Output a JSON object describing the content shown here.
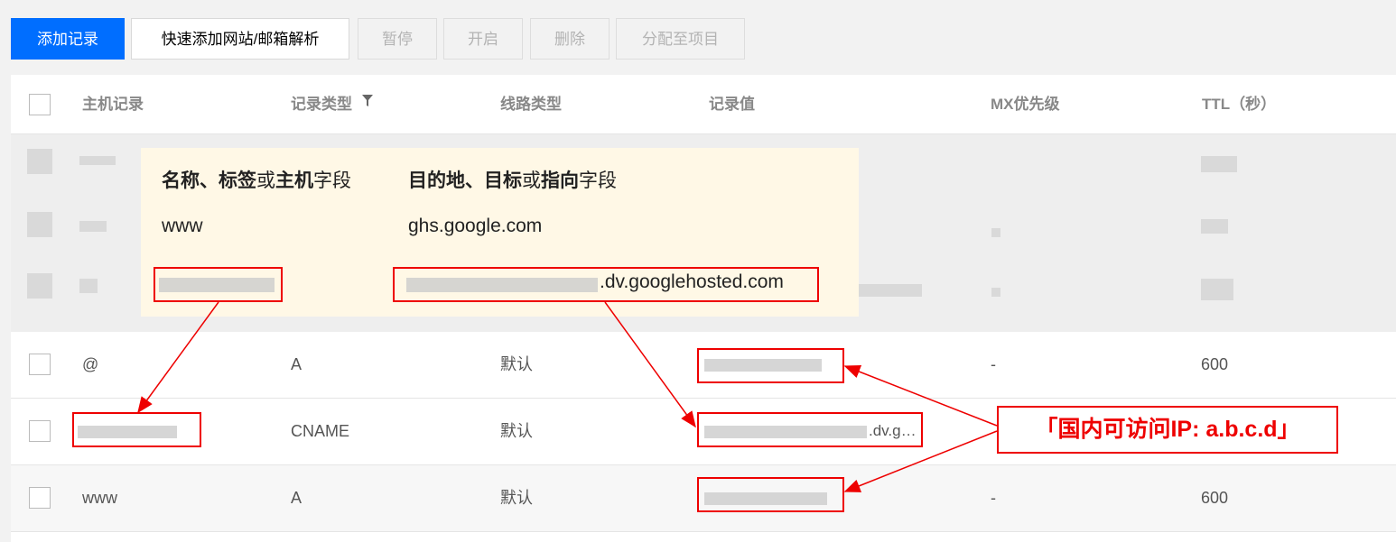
{
  "toolbar": {
    "add_record": "添加记录",
    "quick_add": "快速添加网站/邮箱解析",
    "pause": "暂停",
    "enable": "开启",
    "delete": "删除",
    "assign_project": "分配至项目"
  },
  "table": {
    "columns": {
      "host": "主机记录",
      "type": "记录类型",
      "line": "线路类型",
      "value": "记录值",
      "mx": "MX优先级",
      "ttl": "TTL（秒）"
    },
    "rows": [
      {
        "host": "@",
        "type": "A",
        "line": "默认",
        "value": "",
        "mx": "-",
        "ttl": "600"
      },
      {
        "host": "",
        "type": "CNAME",
        "line": "默认",
        "value": ".dv.g…",
        "mx": "",
        "ttl": ""
      },
      {
        "host": "www",
        "type": "A",
        "line": "默认",
        "value": "",
        "mx": "-",
        "ttl": "600"
      }
    ]
  },
  "tooltip": {
    "header_name_bold1": "名称",
    "header_name_sep": "、",
    "header_name_bold2": "标签",
    "header_name_mid": "或",
    "header_name_bold3": "主机",
    "header_name_tail": "字段",
    "header_dest_bold1": "目的地",
    "header_dest_sep": "、",
    "header_dest_bold2": "目标",
    "header_dest_mid": "或",
    "header_dest_bold3": "指向",
    "header_dest_tail": "字段",
    "row1_name": "www",
    "row1_dest": "ghs.google.com",
    "row2_dest_suffix": ".dv.googlehosted.com"
  },
  "annotation": {
    "note": "「国内可访问IP: a.b.c.d」",
    "color": "#e00000"
  },
  "colors": {
    "primary": "#006eff",
    "tooltip_bg": "#fff8e6"
  }
}
